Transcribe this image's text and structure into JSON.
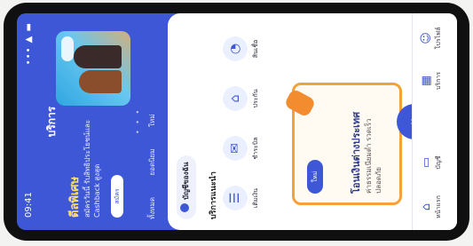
{
  "status": {
    "time": "09:41",
    "indicators": "••• ▲ ▬"
  },
  "header": {
    "title": "บริการ"
  },
  "promo": {
    "title": "ดีลพิเศษ",
    "body": "สมัครวันนี้ รับสิทธิประโยชน์และ Cashback สูงสุด",
    "button": "สมัคร"
  },
  "pager": "• • •",
  "tabs": [
    "ทั้งหมด",
    "ยอดนิยม",
    "ใหม่"
  ],
  "account_chip": "บัญชีของฉัน",
  "section_title": "บริการแนะนำ",
  "services": [
    {
      "icon": "☰",
      "label": "เติมเงิน"
    },
    {
      "icon": "✉",
      "label": "ชำระบิล"
    },
    {
      "icon": "⌂",
      "label": "ประกัน"
    },
    {
      "icon": "◔",
      "label": "สินเชื่อ"
    }
  ],
  "highlight": {
    "badge": "ใหม่",
    "title": "โอนเงินต่างประเทศ",
    "subtitle": "ค่าธรรมเนียมต่ำ รวดเร็ว ปลอดภัย"
  },
  "bottom_nav": [
    {
      "icon": "⌂",
      "label": "หน้าแรก"
    },
    {
      "icon": "▭",
      "label": "บัญชี"
    },
    {
      "icon": "▦",
      "label": "บริการ"
    },
    {
      "icon": "☺",
      "label": "โปรไฟล์"
    }
  ],
  "scan_icon": "⌗",
  "colors": {
    "primary": "#3d57d6",
    "accent": "#f5a13a",
    "promo_title": "#ffe16b"
  }
}
